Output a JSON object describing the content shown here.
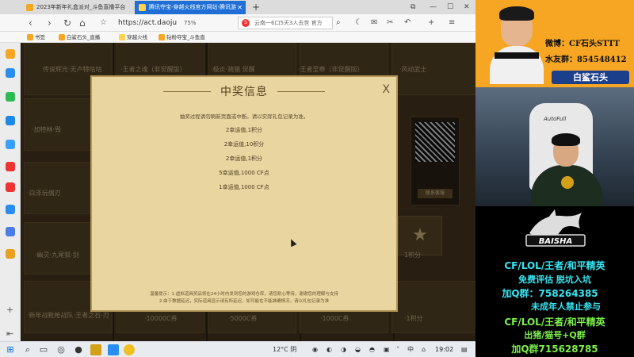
{
  "browser": {
    "tabs": [
      {
        "title": "2023年新年礼盒派对_斗鱼直播平台",
        "icon_color": "#f5a623"
      },
      {
        "title": "腾讯夺宝-穿越火线官方网站-腾讯游",
        "icon_color": "#ffd34d"
      }
    ],
    "url": "https://act.daoju",
    "zoom": "75%",
    "search_text": "云南一6口5天3人去世 官方",
    "bookmarks": [
      {
        "label": "书签",
        "icon_color": "#f5a623"
      },
      {
        "label": "白鲨石头_直播",
        "icon_color": "#f5a623"
      },
      {
        "label": "穿越火线",
        "icon_color": "#ffd34d"
      },
      {
        "label": "钻粉夺宝_斗鱼直",
        "icon_color": "#f5a623"
      }
    ]
  },
  "page": {
    "prize_labels": [
      "传说辉光·无卢特咕咕",
      "·王者之魂（非觉醒版）",
      "·极炎·骑猿 觉醒",
      "·王者至尊（非觉醒版）",
      "·风动武士",
      "·加特林·毁",
      "·白泽玩偶刃",
      "·幽灵·九尾狐·剑",
      "·新年战靴枪战队·王者之石·刃",
      "·10000C券",
      "·5000C券",
      "·1000C券",
      "·1积分"
    ],
    "star_cards": [
      "★",
      "★",
      "★"
    ],
    "star_card_label": "1积分",
    "qr_button": "联系客服"
  },
  "modal": {
    "title": "中奖信息",
    "close": "X",
    "notice": "抽奖过程请勿刷新页面或中断。请以实际礼包记录为准。",
    "records": [
      "2幸运值,1积分",
      "2幸运值,10积分",
      "2幸运值,1积分",
      "5幸运值,1000 CF点",
      "1幸运值,1000 CF点"
    ],
    "footer_line1": "温馨提示：1.虚拟道具奖品将在24小时内发到您的游戏仓库，请您耐心等待，谢谢您的理解与支持",
    "footer_line2": "2.由于数据延迟，实际道具显示请有所延迟，如可能在不能准确情况，请以礼包记录为准"
  },
  "taskbar": {
    "weather": "12°C 阴",
    "ime": "中",
    "time": "19:02"
  },
  "stream": {
    "weibo": "微博：CF石头STTT",
    "fans": "水友群：854548412",
    "nameplate": "白鲨石头",
    "chair_brand": "AutoFull",
    "team_logo": "BAISHA",
    "promo": [
      {
        "text": "CF/LOL/王者/和平精英",
        "color": "#37e6f2"
      },
      {
        "text": "免费评估   脱坑入坑",
        "color": "#37e6f2"
      },
      {
        "text": "加Q群：758264385",
        "color": "#37e6f2"
      },
      {
        "text": "未成年人禁止参与",
        "color": "#37e6f2"
      },
      {
        "text": "CF/LOL/王者/和平精英",
        "color": "#7cf04a"
      },
      {
        "text": "出猪/猫号+Q群",
        "color": "#7cf04a"
      },
      {
        "text": "加Q群715628785",
        "color": "#7cf04a"
      }
    ]
  }
}
